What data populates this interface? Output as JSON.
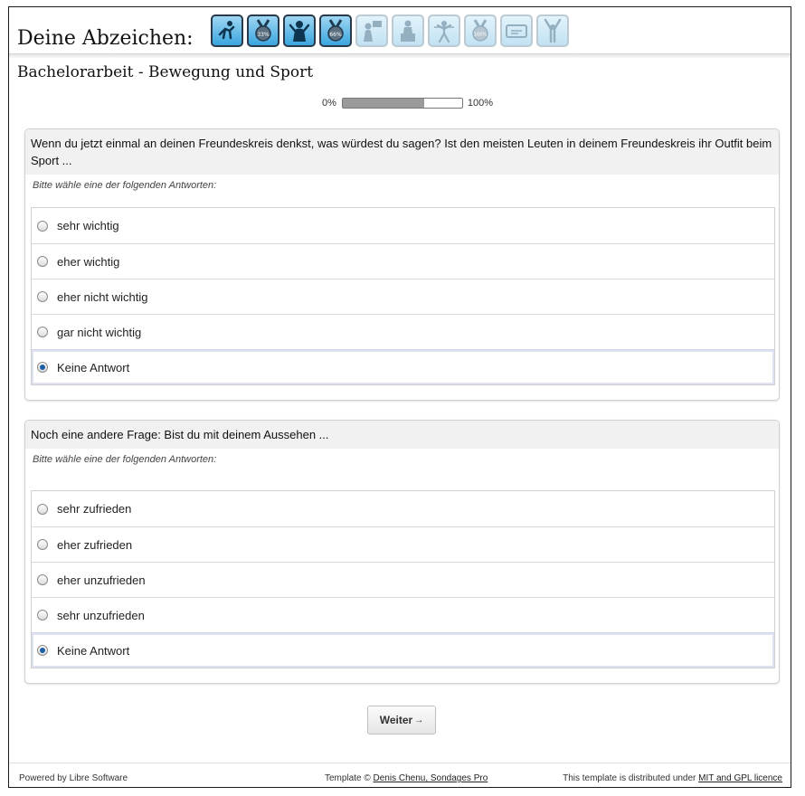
{
  "header": {
    "badges_title": "Deine Abzeichen:",
    "badges": [
      {
        "icon": "runner-icon",
        "earned": true
      },
      {
        "icon": "medal-33-icon",
        "label": "33%",
        "earned": true
      },
      {
        "icon": "athlete-icon",
        "earned": true
      },
      {
        "icon": "medal-66-icon",
        "label": "66%",
        "earned": true
      },
      {
        "icon": "person-sign-icon",
        "earned": false
      },
      {
        "icon": "podium-icon",
        "earned": false
      },
      {
        "icon": "finish-line-icon",
        "earned": false
      },
      {
        "icon": "medal-100-icon",
        "label": "100%",
        "earned": false
      },
      {
        "icon": "ticket-icon",
        "earned": false
      },
      {
        "icon": "victory-icon",
        "earned": false
      }
    ]
  },
  "survey": {
    "title": "Bachelorarbeit - Bewegung und Sport",
    "progress": {
      "min_label": "0%",
      "max_label": "100%",
      "value": 0.68
    }
  },
  "questions": [
    {
      "text": "Wenn du jetzt einmal an deinen Freundeskreis denkst, was würdest du sagen? Ist den meisten Leuten in deinem Freundeskreis ihr Outfit beim Sport ...",
      "help": "Bitte wähle eine der folgenden Antworten:",
      "answers": [
        "sehr wichtig",
        "eher wichtig",
        "eher nicht wichtig",
        "gar nicht wichtig",
        "Keine Antwort"
      ],
      "selected": 4
    },
    {
      "text": "Noch eine andere Frage: Bist du mit deinem Aussehen ...",
      "help": "Bitte wähle eine der folgenden Antworten:",
      "answers": [
        "sehr zufrieden",
        "eher zufrieden",
        "eher unzufrieden",
        "sehr unzufrieden",
        "Keine Antwort"
      ],
      "selected": 4
    }
  ],
  "navigation": {
    "next_label": "Weiter",
    "next_arrow": "→"
  },
  "footer": {
    "powered_by": "Powered by Libre Software",
    "template_prefix": "Template © ",
    "template_author": "Denis Chenu, Sondages Pro",
    "license_prefix": "This template is distributed under ",
    "license_link": "MIT and GPL licence"
  },
  "colors": {
    "selected_radio": "#1b5fa8",
    "badge_blue": "#3aa6de",
    "question_header_bg": "#f1f1f1"
  }
}
